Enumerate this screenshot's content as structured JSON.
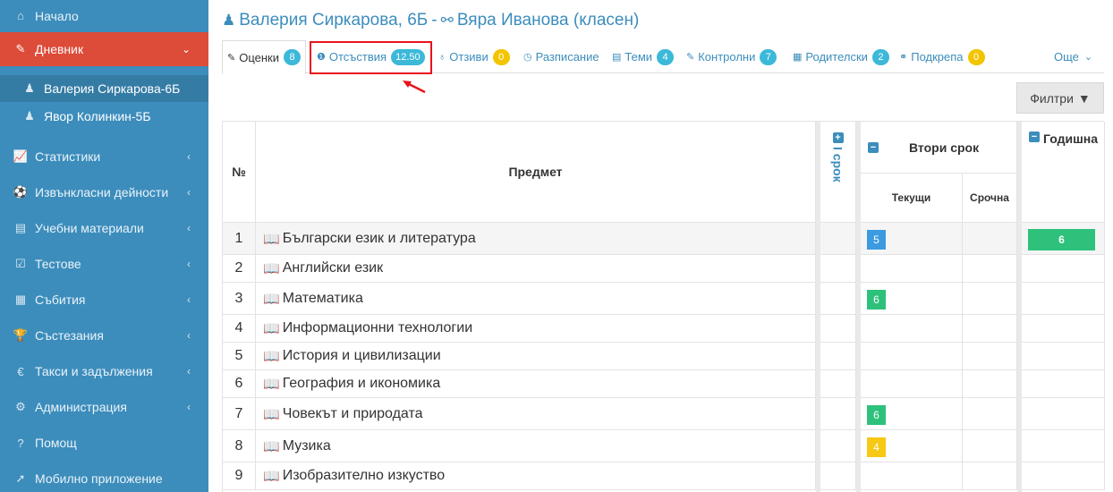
{
  "sidebar": {
    "items": [
      {
        "label": "Начало",
        "icon": "home-icon"
      },
      {
        "label": "Дневник",
        "icon": "edit-icon"
      },
      {
        "label": "Валерия Сиркарова-6Б",
        "icon": "child-icon"
      },
      {
        "label": "Явор Колинкин-5Б",
        "icon": "child-icon"
      },
      {
        "label": "Статистики",
        "icon": "line-chart-icon"
      },
      {
        "label": "Извънкласни дейности",
        "icon": "soccer-ball-icon"
      },
      {
        "label": "Учебни материали",
        "icon": "book-icon"
      },
      {
        "label": "Тестове",
        "icon": "checkbox-icon"
      },
      {
        "label": "Събития",
        "icon": "calendar-icon"
      },
      {
        "label": "Състезания",
        "icon": "trophy-icon"
      },
      {
        "label": "Такси и задължения",
        "icon": "euro-icon"
      },
      {
        "label": "Администрация",
        "icon": "cogs-icon"
      },
      {
        "label": "Помощ",
        "icon": "question-circle-icon"
      },
      {
        "label": "Мобилно приложение",
        "icon": "rocket-icon"
      }
    ]
  },
  "header": {
    "student": "Валерия Сиркарова, 6Б",
    "separator": "-",
    "teacher": "Вяра Иванова (класен)"
  },
  "tabs": [
    {
      "label": "Оценки",
      "badge": "8",
      "icon": "pencil-icon"
    },
    {
      "label": "Отсъствия",
      "badge": "12.50",
      "icon": "exclamation-circle-icon"
    },
    {
      "label": "Отзиви",
      "badge": "0",
      "icon": "award-icon"
    },
    {
      "label": "Разписание",
      "icon": "clock-icon"
    },
    {
      "label": "Теми",
      "badge": "4",
      "icon": "list-icon"
    },
    {
      "label": "Контролни",
      "badge": "7",
      "icon": "edit-icon"
    },
    {
      "label": "Родителски",
      "badge": "2",
      "icon": "calendar-icon"
    },
    {
      "label": "Подкрепа",
      "badge": "0",
      "icon": "handshake-icon"
    },
    {
      "label": "Още",
      "icon": "chevron-down-icon"
    }
  ],
  "filter": {
    "label": "Филтри",
    "icon": "filter-icon"
  },
  "table": {
    "col_no": "№",
    "col_subject": "Предмет",
    "term1": "I срок",
    "term2": "Втори срок",
    "term2_current": "Текущи",
    "term2_deadline": "Срочна",
    "annual": "Годишна",
    "rows": [
      {
        "no": "1",
        "subject": "Български език и литература",
        "current": "5",
        "annual": "6"
      },
      {
        "no": "2",
        "subject": "Английски език"
      },
      {
        "no": "3",
        "subject": "Математика",
        "current": "6"
      },
      {
        "no": "4",
        "subject": "Информационни технологии"
      },
      {
        "no": "5",
        "subject": "История и цивилизации"
      },
      {
        "no": "6",
        "subject": "География и икономика"
      },
      {
        "no": "7",
        "subject": "Човекът и природата",
        "current": "6"
      },
      {
        "no": "8",
        "subject": "Музика",
        "current": "4"
      },
      {
        "no": "9",
        "subject": "Изобразително изкуство"
      }
    ]
  },
  "colors": {
    "sidebar": "#3c8dbc",
    "active": "#dd4b39",
    "highlight": "#e8131b",
    "grade_blue": "#3c9be0",
    "grade_green": "#2ec17b",
    "grade_yellow": "#f7c814"
  }
}
